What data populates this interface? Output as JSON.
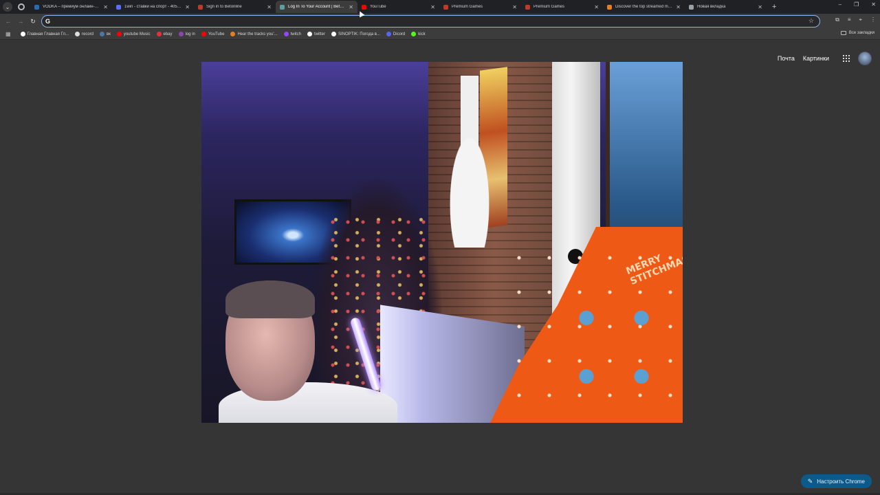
{
  "tabs": [
    {
      "title": "VODKA – премиум онлайн-ка...",
      "favicon_color": "#2b6cb0",
      "active": false
    },
    {
      "title": "1win - ставки на спорт - 4050...",
      "favicon_color": "#5a6cff",
      "active": false
    },
    {
      "title": "Sign in to Betonline",
      "favicon_color": "#c0392b",
      "active": false
    },
    {
      "title": "Log In To Your Account | BetOn...",
      "favicon_color": "#5f9ea0",
      "active": true
    },
    {
      "title": "YouTube",
      "favicon_color": "#ff0000",
      "active": false
    },
    {
      "title": "Premium Games",
      "favicon_color": "#c0392b",
      "active": false
    },
    {
      "title": "Premium Games",
      "favicon_color": "#c0392b",
      "active": false
    },
    {
      "title": "Discover the top streamed mu...",
      "favicon_color": "#e67e22",
      "active": false
    },
    {
      "title": "Новая вкладка",
      "favicon_color": "#9aa0a6",
      "active": false
    }
  ],
  "omnibox": {
    "value": "",
    "placeholder": ""
  },
  "bookmarks": [
    {
      "label": "Главная Главная Гл...",
      "favicon_color": "#ffffff"
    },
    {
      "label": "record",
      "favicon_color": "#dddddd"
    },
    {
      "label": "вк",
      "favicon_color": "#4a76a8"
    },
    {
      "label": "youtube Music",
      "favicon_color": "#ff0000"
    },
    {
      "label": "ebay",
      "favicon_color": "#e53238"
    },
    {
      "label": "log in",
      "favicon_color": "#8e44ad"
    },
    {
      "label": "YouTube",
      "favicon_color": "#ff0000"
    },
    {
      "label": "Hear the tracks you'...",
      "favicon_color": "#e67e22"
    },
    {
      "label": "twitch",
      "favicon_color": "#9146ff"
    },
    {
      "label": "twitter",
      "favicon_color": "#ffffff"
    },
    {
      "label": "SINOPTIK: Погода в...",
      "favicon_color": "#ffffff"
    },
    {
      "label": "Dicord",
      "favicon_color": "#5865f2"
    },
    {
      "label": "kick",
      "favicon_color": "#53fc18"
    }
  ],
  "bookmarks_all": "Все закладки",
  "google": {
    "mail": "Почта",
    "images": "Картинки"
  },
  "customize_button": "Настроить Chrome"
}
